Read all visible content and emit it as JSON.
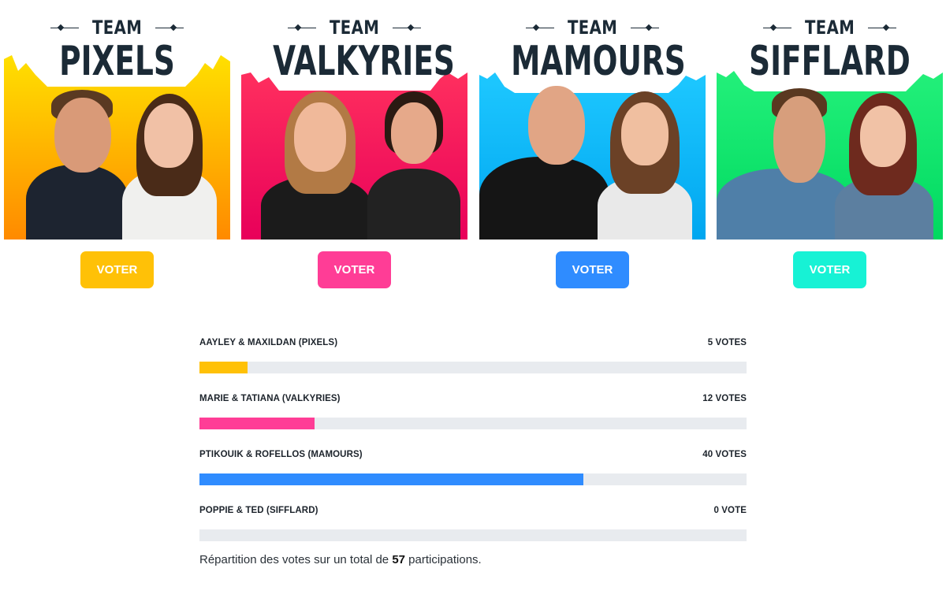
{
  "teams": [
    {
      "team_word": "TEAM",
      "name": "PIXELS",
      "vote_label": "VOTER",
      "color": "#FFC107",
      "splash": [
        "#FFE000",
        "#FF8A00"
      ]
    },
    {
      "team_word": "TEAM",
      "name": "VALKYRIES",
      "vote_label": "VOTER",
      "color": "#FF3D96",
      "splash": [
        "#FF2F5E",
        "#E8005A"
      ]
    },
    {
      "team_word": "TEAM",
      "name": "MAMOURS",
      "vote_label": "VOTER",
      "color": "#2F8CFF",
      "splash": [
        "#1EC8FF",
        "#00A6F0"
      ]
    },
    {
      "team_word": "TEAM",
      "name": "SIFFLARD",
      "vote_label": "VOTER",
      "color": "#17F2D5",
      "splash": [
        "#23F07A",
        "#00D960"
      ]
    }
  ],
  "results": [
    {
      "label": "AAYLEY & MAXILDAN (PIXELS)",
      "votes_text": "5 VOTES",
      "votes": 5,
      "share": 0.0877,
      "color": "#FFC107"
    },
    {
      "label": "MARIE & TATIANA (VALKYRIES)",
      "votes_text": "12 VOTES",
      "votes": 12,
      "share": 0.2105,
      "color": "#FF3D96"
    },
    {
      "label": "PTIKOUIK & ROFELLOS (MAMOURS)",
      "votes_text": "40 VOTES",
      "votes": 40,
      "share": 0.7018,
      "color": "#2F8CFF"
    },
    {
      "label": "POPPIE & TED (SIFFLARD)",
      "votes_text": "0 VOTE",
      "votes": 0,
      "share": 0,
      "color": "#17F2D5"
    }
  ],
  "summary": {
    "before": "Répartition des votes sur un total de ",
    "total": "57",
    "after": " participations."
  }
}
